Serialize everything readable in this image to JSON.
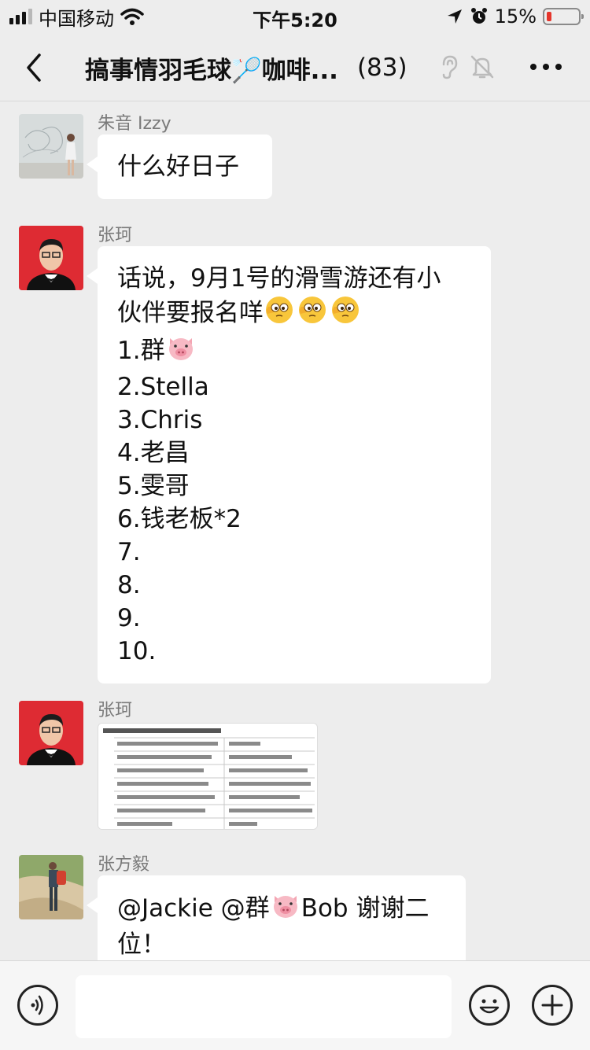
{
  "status_bar": {
    "carrier": "中国移动",
    "time": "下午5:20",
    "battery_pct": "15%",
    "icons": [
      "signal-icon",
      "wifi-icon",
      "location-icon",
      "alarm-icon",
      "battery-icon"
    ],
    "battery_level": 0.15,
    "battery_color": "#e5352b"
  },
  "header": {
    "title": "搞事情羽毛球🏸咖啡...",
    "member_count": "(83)",
    "icons": [
      "back-icon",
      "ear-icon",
      "mute-bell-icon",
      "more-icon"
    ]
  },
  "messages": [
    {
      "sender": "朱音 Izzy",
      "type": "text",
      "lines": [
        "什么好日子"
      ]
    },
    {
      "sender": "张珂",
      "type": "text",
      "lines": [
        "话说，9月1号的滑雪游还有小",
        "伙伴要报名咩",
        "1.群",
        "2.Stella",
        "3.Chris",
        "4.老昌",
        "5.雯哥",
        "6.钱老板*2",
        "7.",
        "8.",
        "9.",
        "10."
      ]
    },
    {
      "sender": "张珂",
      "type": "image",
      "image_alt": "schedule-table-image"
    },
    {
      "sender": "张方毅",
      "type": "text",
      "lines": [
        "@Jackie @群",
        "Bob 谢谢二",
        "位！"
      ]
    }
  ],
  "input_bar": {
    "placeholder": "",
    "icons": [
      "voice-icon",
      "emoji-icon",
      "plus-icon"
    ]
  },
  "colors": {
    "background": "#ededed",
    "bubble": "#ffffff",
    "sender_text": "#7a7a7a"
  }
}
